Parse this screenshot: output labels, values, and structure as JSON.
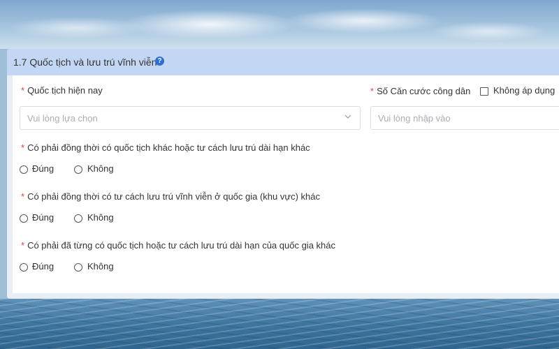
{
  "section": {
    "title": "1.7 Quốc tịch và lưu trú vĩnh viễn",
    "help_icon": "question-circle-icon",
    "accent_color": "#2f6fd1",
    "header_bg": "#c3d6f3"
  },
  "fields": {
    "nationality": {
      "required_mark": "*",
      "label": "Quốc tịch hiện nay",
      "placeholder": "Vui lòng lựa chọn",
      "value": ""
    },
    "citizen_id": {
      "required_mark": "*",
      "label": "Số Căn cước công dân",
      "placeholder": "Vui lòng nhập vào",
      "value": "",
      "not_applicable_label": "Không áp dụng",
      "not_applicable_checked": false
    }
  },
  "questions": [
    {
      "required_mark": "*",
      "label": "Có phải đồng thời có quốc tịch khác hoặc tư cách lưu trú dài hạn khác",
      "options": [
        "Đúng",
        "Không"
      ],
      "selected": null
    },
    {
      "required_mark": "*",
      "label": "Có phải đồng thời có tư cách lưu trú vĩnh viễn ở quốc gia (khu vực) khác",
      "options": [
        "Đúng",
        "Không"
      ],
      "selected": null
    },
    {
      "required_mark": "*",
      "label": "Có phải đã từng có quốc tịch hoặc tư cách lưu trú dài hạn của quốc gia khác",
      "options": [
        "Đúng",
        "Không"
      ],
      "selected": null
    }
  ]
}
